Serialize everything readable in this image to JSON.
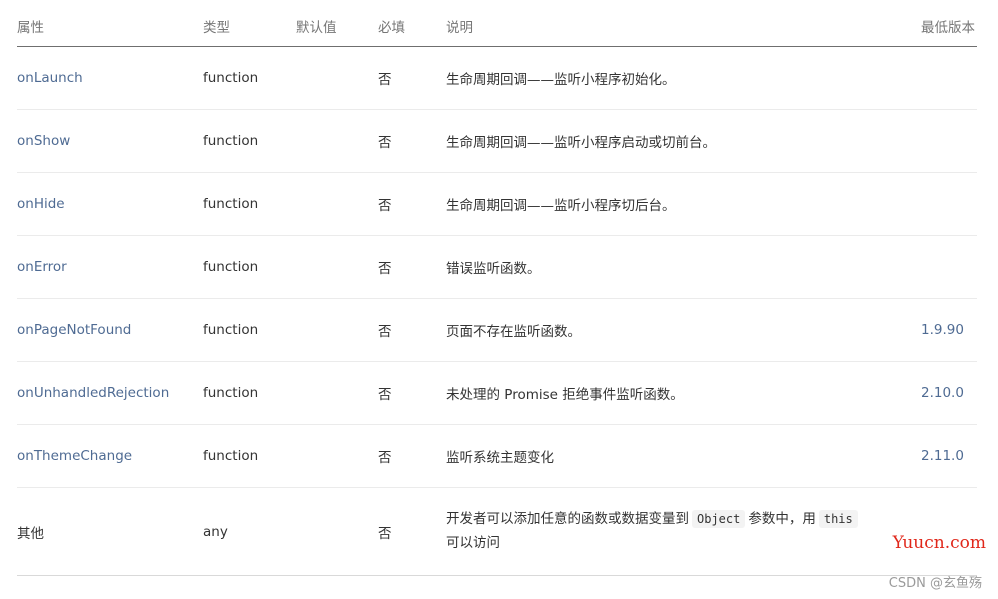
{
  "table": {
    "headers": {
      "name": "属性",
      "type": "类型",
      "default": "默认值",
      "required": "必填",
      "description": "说明",
      "min_version": "最低版本"
    },
    "rows": [
      {
        "name": "onLaunch",
        "type": "function",
        "default": "",
        "required": "否",
        "description": "生命周期回调——监听小程序初始化。",
        "min_version": ""
      },
      {
        "name": "onShow",
        "type": "function",
        "default": "",
        "required": "否",
        "description": "生命周期回调——监听小程序启动或切前台。",
        "min_version": ""
      },
      {
        "name": "onHide",
        "type": "function",
        "default": "",
        "required": "否",
        "description": "生命周期回调——监听小程序切后台。",
        "min_version": ""
      },
      {
        "name": "onError",
        "type": "function",
        "default": "",
        "required": "否",
        "description": "错误监听函数。",
        "min_version": ""
      },
      {
        "name": "onPageNotFound",
        "type": "function",
        "default": "",
        "required": "否",
        "description": "页面不存在监听函数。",
        "min_version": "1.9.90"
      },
      {
        "name": "onUnhandledRejection",
        "type": "function",
        "default": "",
        "required": "否",
        "description": "未处理的 Promise 拒绝事件监听函数。",
        "min_version": "2.10.0"
      },
      {
        "name": "onThemeChange",
        "type": "function",
        "default": "",
        "required": "否",
        "description": "监听系统主题变化",
        "min_version": "2.11.0"
      }
    ],
    "last_row": {
      "name": "其他",
      "type": "any",
      "default": "",
      "required": "否",
      "description_parts": {
        "text1": "开发者可以添加任意的函数或数据变量到",
        "code1": "Object",
        "text2": "参数中，用",
        "code2": "this",
        "text3": "可以访问"
      },
      "min_version": ""
    }
  },
  "watermarks": {
    "site": "Yuucn.com",
    "csdn": "CSDN @玄鱼殇"
  },
  "colors": {
    "link": "#4f6b93",
    "header_text": "#767676",
    "body_text": "#333333",
    "watermark_red": "#e0271a"
  }
}
